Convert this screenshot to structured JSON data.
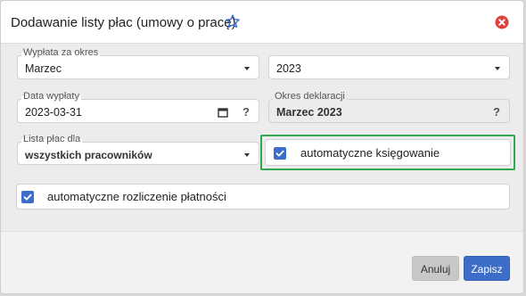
{
  "dialog": {
    "title": "Dodawanie listy płac (umowy o pracę)",
    "icons": {
      "favorite": "star-outline-icon",
      "close": "close-circle-icon"
    }
  },
  "form": {
    "payout_period": {
      "label": "Wypłata za okres",
      "month": "Marzec",
      "year": "2023"
    },
    "payout_date": {
      "label": "Data wypłaty",
      "value": "2023-03-31",
      "help": "?"
    },
    "declaration_period": {
      "label": "Okres deklaracji",
      "value": "Marzec 2023",
      "help": "?"
    },
    "payroll_for": {
      "label": "Lista płac dla",
      "value": "wszystkich pracowników"
    },
    "auto_posting": {
      "label": "automatyczne księgowanie",
      "checked": true
    },
    "auto_payment_settlement": {
      "label": "automatyczne rozliczenie płatności",
      "checked": true
    }
  },
  "footer": {
    "cancel_label": "Anuluj",
    "save_label": "Zapisz"
  },
  "colors": {
    "accent": "#3b6dc9",
    "close_red": "#e0413a",
    "highlight_green": "#2fa84f"
  }
}
